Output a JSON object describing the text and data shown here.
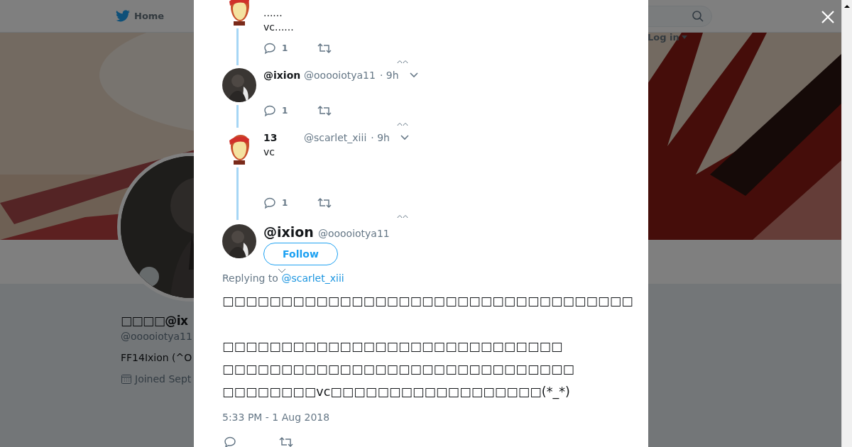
{
  "nav": {
    "home": "Home",
    "login": "Log in"
  },
  "profile": {
    "name": "□□□□@ix",
    "handle": "@ooooiotya11",
    "bio": "FF14Ixion (^O",
    "joined": "Joined Sept"
  },
  "thread": [
    {
      "avatar": {
        "kind": "headband"
      },
      "text": "......\nvc......",
      "replies": "1"
    },
    {
      "avatar": {
        "kind": "dark"
      },
      "name": "@ixion",
      "handle": "@ooooiotya11",
      "time": "· 9h",
      "replies": "1"
    },
    {
      "avatar": {
        "kind": "headband"
      },
      "name": "13",
      "handle": "@scarlet_xiii",
      "time": "· 9h",
      "text": "vc",
      "replies": "1"
    }
  ],
  "tweet": {
    "avatar": {
      "kind": "dark"
    },
    "name": "@ixion",
    "handle": "@ooooiotya11",
    "follow": "Follow",
    "replying_prefix": "Replying to",
    "replying_to": "@scarlet_xiii",
    "text": "□□□□□□□□□□□□□□□□□□□□□□□□□□□□□□□□□□□\n\n□□□□□□□□□□□□□□□□□□□□□□□□□□□□□\n□□□□□□□□□□□□□□□□□□□□□□□□□□□□□□\n□□□□□□□□vc□□□□□□□□□□□□□□□□□□(*_*)",
    "timestamp": "5:33 PM - 1 Aug 2018"
  }
}
